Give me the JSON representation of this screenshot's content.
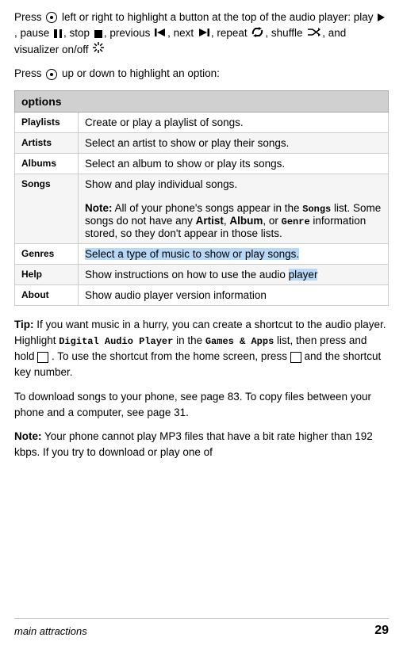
{
  "intro1": {
    "text": "Press",
    "nav_desc": " left or right to highlight a button at the top of the audio player: play ",
    "play_label": "▶",
    "pause_label": "⏸",
    "stop_label": "■",
    "prev_label": "◀◀",
    "next_label": "▶▶",
    "repeat_label": "↺",
    "shuffle_label": "⇄",
    "viz_label": "✦",
    "rest": ", pause , stop , previous , next , repeat , shuffle , and visualizer on/off"
  },
  "intro2": "Press · up or down to highlight an option:",
  "table": {
    "header": "options",
    "rows": [
      {
        "option": "Playlists",
        "description": "Create or play a playlist of songs."
      },
      {
        "option": "Artists",
        "description": "Select an artist to show or play their songs."
      },
      {
        "option": "Albums",
        "description": "Select an album to show or play its songs."
      },
      {
        "option": "Songs",
        "description": "Show and play individual songs.",
        "note": "Note: All of your phone’s songs appear in the Songs list. Some songs do not have any Artist, Album, or Genre information stored, so they don’t appear in those lists."
      },
      {
        "option": "Genres",
        "description": "Select a type of music to show or play songs."
      },
      {
        "option": "Help",
        "description": "Show instructions on how to use the audio player"
      },
      {
        "option": "About",
        "description": "Show audio player version information"
      }
    ]
  },
  "tip": {
    "label": "Tip:",
    "text": " If you want music in a hurry, you can create a shortcut to the audio player. Highlight ",
    "highlight1": "Digital Audio Player",
    "text2": " in the ",
    "highlight2": "Games & Apps",
    "text3": " list, then press and hold ",
    "icon_desc": "□",
    "text4": ". To use the shortcut from the home screen, press ",
    "icon_desc2": "□",
    "text5": " and the shortcut key number."
  },
  "download": "To download songs to your phone, see page 83. To copy files between your phone and a computer, see page 31.",
  "note": {
    "label": "Note:",
    "text": " Your phone cannot play MP3 files that have a bit rate higher than 192 kbps. If you try to download or play one of"
  },
  "footer": {
    "section": "main attractions",
    "page": "29"
  }
}
